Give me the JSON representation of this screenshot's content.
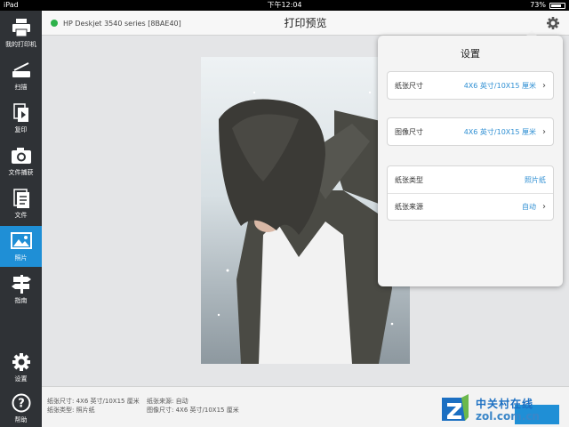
{
  "status_bar": {
    "device": "iPad",
    "time": "下午12:04",
    "battery_percent": "73%",
    "battery_level": 0.73
  },
  "header": {
    "printer_name": "HP Deskjet 3540 series [8BAE40]",
    "printer_status_color": "#2db24a",
    "title": "打印预览",
    "settings_icon": "gear-icon"
  },
  "sidebar": {
    "items": [
      {
        "label": "我的打印机",
        "icon": "printer-icon"
      },
      {
        "label": "扫描",
        "icon": "scanner-icon"
      },
      {
        "label": "复印",
        "icon": "copy-icon"
      },
      {
        "label": "文件捕获",
        "icon": "camera-icon"
      },
      {
        "label": "文件",
        "icon": "document-icon"
      },
      {
        "label": "照片",
        "icon": "photo-icon",
        "active": true
      },
      {
        "label": "指南",
        "icon": "signpost-icon"
      }
    ],
    "bottom_items": [
      {
        "label": "设置",
        "icon": "gear-icon"
      },
      {
        "label": "帮助",
        "icon": "help-icon"
      }
    ],
    "accent_color": "#1f8fd6"
  },
  "settings": {
    "title": "设置",
    "paper_size": {
      "label": "纸张尺寸",
      "value": "4X6 英寸/10X15 厘米"
    },
    "image_size": {
      "label": "图像尺寸",
      "value": "4X6 英寸/10X15 厘米"
    },
    "paper_type": {
      "label": "纸张类型",
      "value": "照片纸"
    },
    "paper_source": {
      "label": "纸张来源",
      "value": "自动"
    }
  },
  "info_bar": {
    "line1_left": "纸张尺寸: 4X6 英寸/10X15 厘米",
    "line2_left": "纸张类型: 照片纸",
    "line1_right": "纸张来源: 自动",
    "line2_right": "图像尺寸: 4X6 英寸/10X15 厘米"
  },
  "watermark": {
    "cn": "中关村在线",
    "en": "zol.com.cn"
  }
}
